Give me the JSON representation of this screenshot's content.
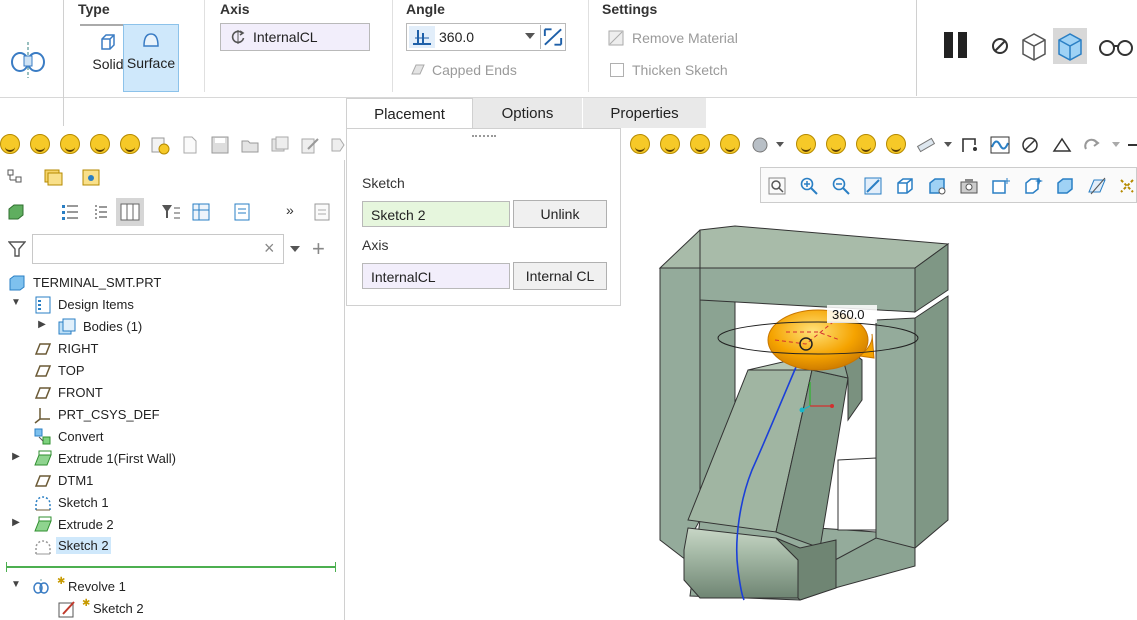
{
  "ribbon": {
    "type_group": {
      "title": "Type",
      "solid_label": "Solid",
      "surface_label": "Surface",
      "active": "Surface"
    },
    "axis_group": {
      "title": "Axis",
      "value": "InternalCL"
    },
    "angle_group": {
      "title": "Angle",
      "value": "360.0",
      "capped_ends": "Capped Ends"
    },
    "settings_group": {
      "title": "Settings",
      "remove_material": "Remove Material",
      "thicken_sketch": "Thicken Sketch"
    }
  },
  "tabs": [
    {
      "label": "Placement",
      "active": true
    },
    {
      "label": "Options",
      "active": false
    },
    {
      "label": "Properties",
      "active": false
    }
  ],
  "placement": {
    "sketch_label": "Sketch",
    "sketch_value": "Sketch 2",
    "unlink_label": "Unlink",
    "axis_label": "Axis",
    "axis_value": "InternalCL",
    "internal_cl_label": "Internal CL"
  },
  "tree": {
    "filter_placeholder": "",
    "items": [
      {
        "label": "TERMINAL_SMT.PRT",
        "icon": "part-icon"
      },
      {
        "label": "Design Items",
        "icon": "design-items-icon"
      },
      {
        "label": "Bodies (1)",
        "icon": "bodies-icon"
      },
      {
        "label": "RIGHT",
        "icon": "datum-plane-icon"
      },
      {
        "label": "TOP",
        "icon": "datum-plane-icon"
      },
      {
        "label": "FRONT",
        "icon": "datum-plane-icon"
      },
      {
        "label": "PRT_CSYS_DEF",
        "icon": "csys-icon"
      },
      {
        "label": "Convert",
        "icon": "convert-icon"
      },
      {
        "label": "Extrude 1(First Wall)",
        "icon": "extrude-icon"
      },
      {
        "label": "DTM1",
        "icon": "datum-plane-icon"
      },
      {
        "label": "Sketch 1",
        "icon": "sketch-icon"
      },
      {
        "label": "Extrude 2",
        "icon": "extrude-icon"
      },
      {
        "label": "Sketch 2",
        "icon": "sketch-icon"
      },
      {
        "label": "Revolve 1",
        "icon": "revolve-icon"
      },
      {
        "label": "Sketch 2",
        "icon": "sketch-edit-icon"
      }
    ]
  },
  "viewport": {
    "angle_dimension": "360.0"
  },
  "colors": {
    "accent": "#cfe8fb",
    "model": "#94ab9b",
    "revolve_preview": "#f5a300",
    "insert_line": "#4caf50"
  }
}
